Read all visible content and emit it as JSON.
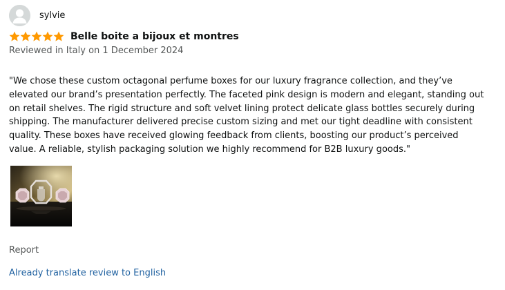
{
  "profile": {
    "name": "sylvie",
    "avatar_icon": "user-silhouette-icon"
  },
  "rating": {
    "stars": 5,
    "max": 5,
    "color": "#ff9900"
  },
  "review": {
    "title": "Belle boite a bijoux et montres",
    "date": "Reviewed in Italy on 1 December 2024",
    "body": "\"We chose these custom octagonal perfume boxes for our luxury fragrance collection, and they’ve elevated our brand’s presentation perfectly. The faceted pink design is modern and elegant, standing out on retail shelves. The rigid structure and soft velvet lining protect delicate glass bottles securely during shipping. The manufacturer delivered precise custom sizing and met our tight deadline with consistent quality. These boxes have received glowing feedback from clients, boosting our product’s perceived value. A reliable, stylish packaging solution we highly recommend for B2B luxury goods.\""
  },
  "actions": {
    "report_label": "Report",
    "translate_label": "Already translate review to English"
  },
  "colors": {
    "text": "#0f1111",
    "muted": "#565959",
    "link": "#2162a1",
    "star": "#ff9900"
  }
}
